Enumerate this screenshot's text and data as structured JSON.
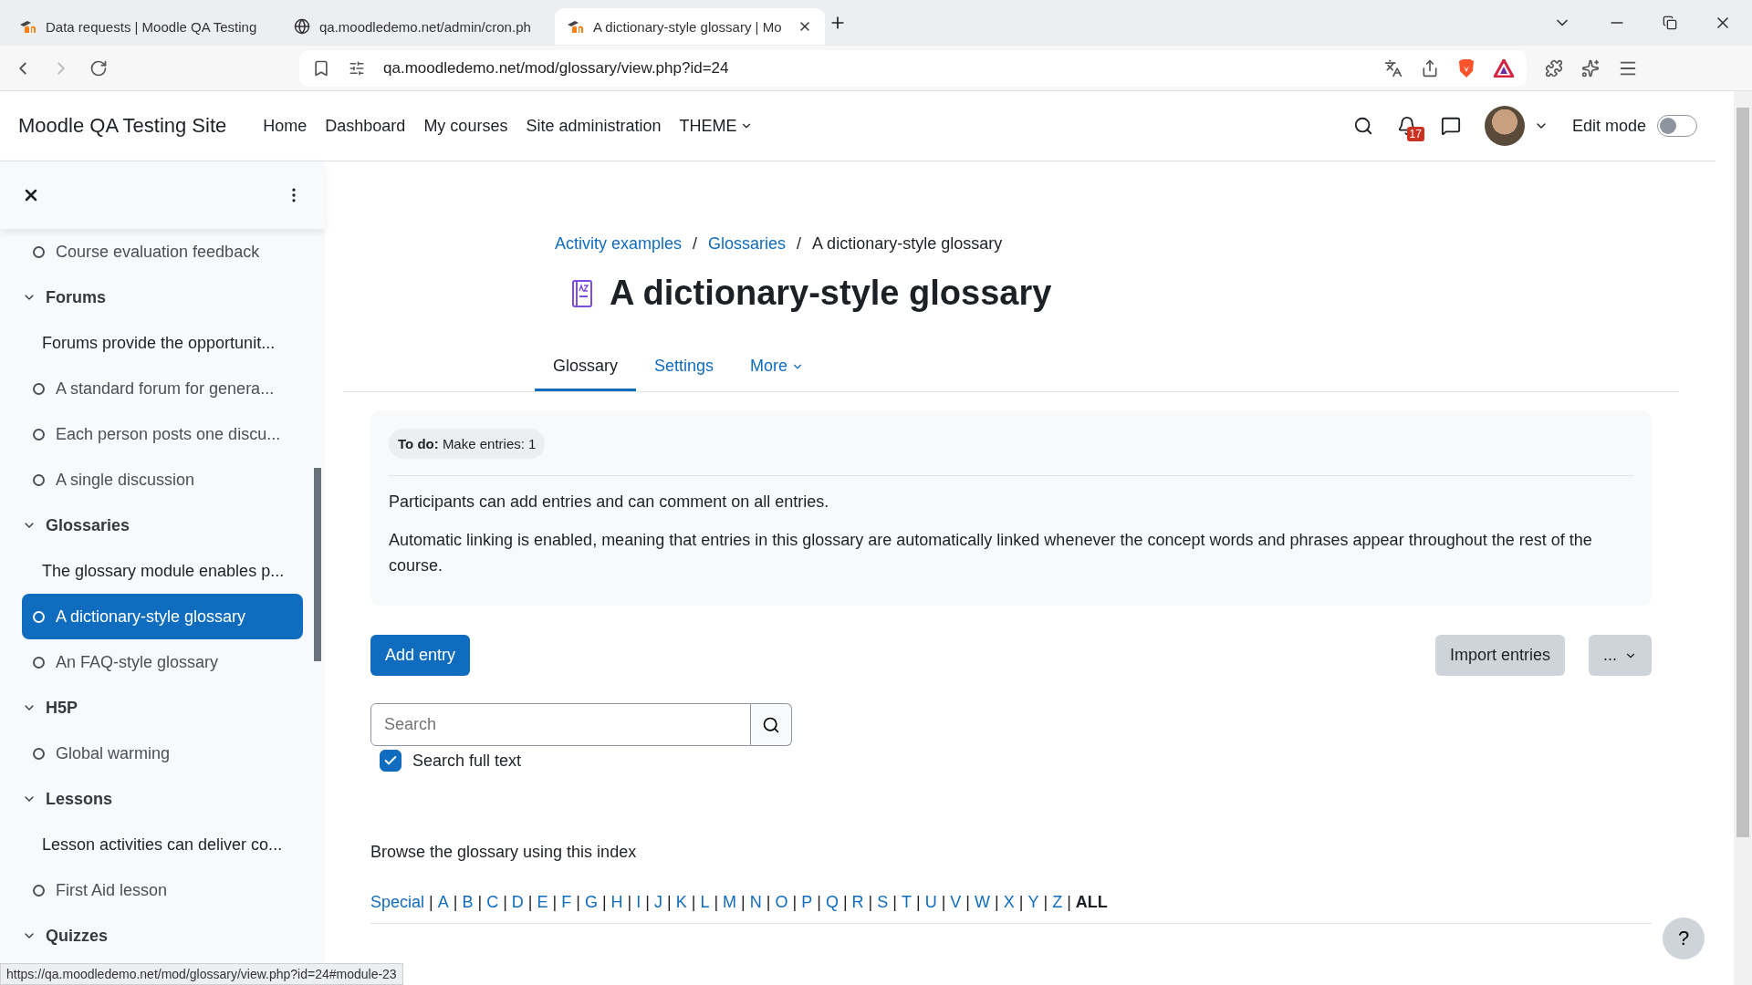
{
  "browser": {
    "tabs": [
      {
        "title": "Data requests | Moodle QA Testing",
        "kind": "moodle",
        "selected": false
      },
      {
        "title": "qa.moodledemo.net/admin/cron.ph",
        "kind": "globe",
        "selected": false
      },
      {
        "title": "A dictionary-style glossary | Mo",
        "kind": "moodle",
        "selected": true
      }
    ],
    "url": "qa.moodledemo.net/mod/glossary/view.php?id=24"
  },
  "navbar": {
    "site_name": "Moodle QA Testing Site",
    "items": [
      {
        "label": "Home",
        "kind": "link"
      },
      {
        "label": "Dashboard",
        "kind": "link"
      },
      {
        "label": "My courses",
        "kind": "link"
      },
      {
        "label": "Site administration",
        "kind": "link"
      },
      {
        "label": "THEME",
        "kind": "menu"
      }
    ],
    "notification_count": "17",
    "edit_mode": {
      "label": "Edit mode",
      "on": false
    }
  },
  "sidebar": {
    "items": [
      {
        "kind": "activity",
        "label": "Course evaluation feedback",
        "selected": false
      },
      {
        "kind": "section",
        "label": "Forums",
        "expanded": true,
        "children": [
          {
            "kind": "summary",
            "label": "Forums provide the opportunit...",
            "selected": false
          },
          {
            "kind": "activity",
            "label": "A standard forum for genera...",
            "selected": false
          },
          {
            "kind": "activity",
            "label": "Each person posts one discu...",
            "selected": false
          },
          {
            "kind": "activity",
            "label": "A single discussion",
            "selected": false
          }
        ]
      },
      {
        "kind": "section",
        "label": "Glossaries",
        "expanded": true,
        "children": [
          {
            "kind": "summary",
            "label": "The glossary module enables p...",
            "selected": false
          },
          {
            "kind": "activity",
            "label": "A dictionary-style glossary",
            "selected": true
          },
          {
            "kind": "activity",
            "label": "An FAQ-style glossary",
            "selected": false
          }
        ]
      },
      {
        "kind": "section",
        "label": "H5P",
        "expanded": true,
        "children": [
          {
            "kind": "activity",
            "label": "Global warming",
            "selected": false
          }
        ]
      },
      {
        "kind": "section",
        "label": "Lessons",
        "expanded": true,
        "children": [
          {
            "kind": "summary",
            "label": "Lesson activities can deliver co...",
            "selected": false
          },
          {
            "kind": "activity",
            "label": "First Aid lesson",
            "selected": false
          }
        ]
      },
      {
        "kind": "section",
        "label": "Quizzes",
        "expanded": true
      }
    ]
  },
  "main": {
    "breadcrumb_separator": "/",
    "index_separator": "|",
    "breadcrumb": [
      {
        "label": "Activity examples",
        "link": true
      },
      {
        "label": "Glossaries",
        "link": true
      },
      {
        "label": "A dictionary-style glossary",
        "link": false
      }
    ],
    "title": "A dictionary-style glossary",
    "tabs": [
      {
        "label": "Glossary",
        "kind": "link",
        "selected": true
      },
      {
        "label": "Settings",
        "kind": "link",
        "selected": false
      },
      {
        "label": "More",
        "kind": "menu",
        "selected": false
      }
    ],
    "todo": {
      "label": "To do:",
      "text": "Make entries: 1"
    },
    "description": [
      "Participants can add entries and can comment on all entries.",
      "Automatic linking is enabled, meaning that entries in this glossary are automatically linked whenever the concept words and phrases appear throughout the rest of the course."
    ],
    "add_button": "Add entry",
    "import_button": "Import entries",
    "more_button": "...",
    "search": {
      "placeholder": "Search"
    },
    "search_full_text": {
      "label": "Search full text",
      "checked": true
    },
    "browse_text": "Browse the glossary using this index",
    "index": [
      {
        "label": "Special",
        "selected": false
      },
      {
        "label": "A",
        "selected": false
      },
      {
        "label": "B",
        "selected": false
      },
      {
        "label": "C",
        "selected": false
      },
      {
        "label": "D",
        "selected": false
      },
      {
        "label": "E",
        "selected": false
      },
      {
        "label": "F",
        "selected": false
      },
      {
        "label": "G",
        "selected": false
      },
      {
        "label": "H",
        "selected": false
      },
      {
        "label": "I",
        "selected": false
      },
      {
        "label": "J",
        "selected": false
      },
      {
        "label": "K",
        "selected": false
      },
      {
        "label": "L",
        "selected": false
      },
      {
        "label": "M",
        "selected": false
      },
      {
        "label": "N",
        "selected": false
      },
      {
        "label": "O",
        "selected": false
      },
      {
        "label": "P",
        "selected": false
      },
      {
        "label": "Q",
        "selected": false
      },
      {
        "label": "R",
        "selected": false
      },
      {
        "label": "S",
        "selected": false
      },
      {
        "label": "T",
        "selected": false
      },
      {
        "label": "U",
        "selected": false
      },
      {
        "label": "V",
        "selected": false
      },
      {
        "label": "W",
        "selected": false
      },
      {
        "label": "X",
        "selected": false
      },
      {
        "label": "Y",
        "selected": false
      },
      {
        "label": "Z",
        "selected": false
      },
      {
        "label": "ALL",
        "selected": true
      }
    ],
    "help": "?"
  },
  "status_url": "https://qa.moodledemo.net/mod/glossary/view.php?id=24#module-23"
}
